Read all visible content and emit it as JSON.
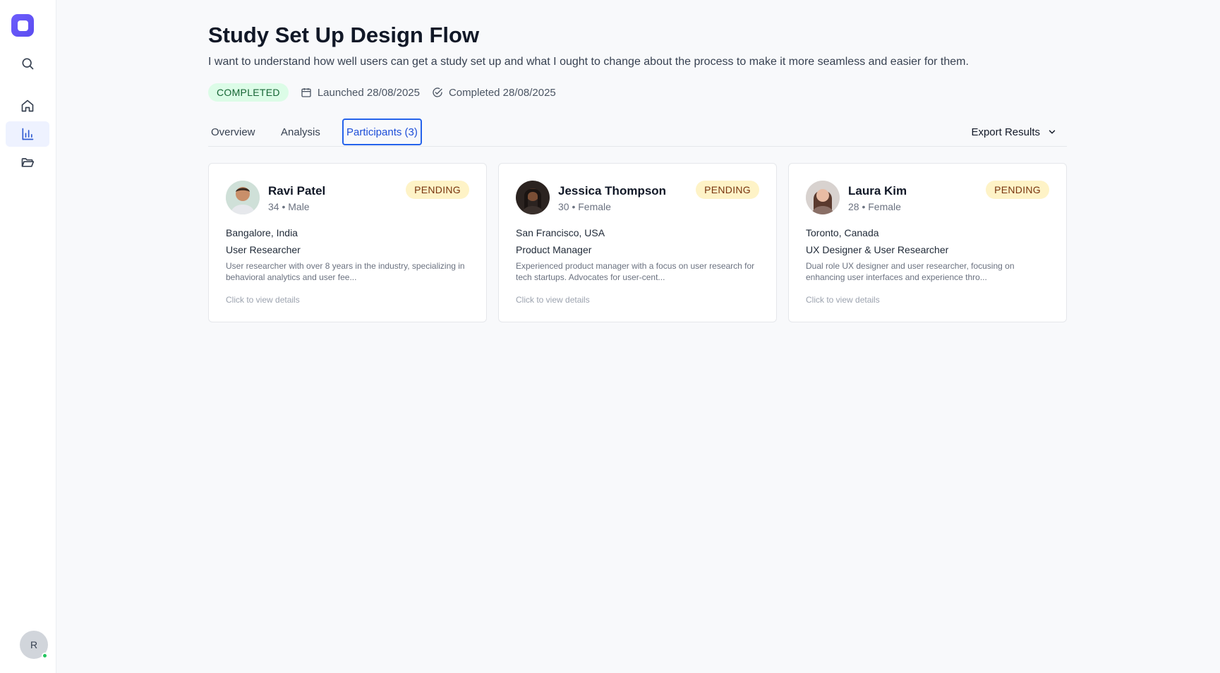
{
  "sidebar": {
    "avatar_initial": "R",
    "items": [
      {
        "name": "search-icon"
      },
      {
        "name": "home-icon"
      },
      {
        "name": "bar-chart-icon",
        "active": true
      },
      {
        "name": "folder-icon"
      }
    ]
  },
  "study": {
    "title": "Study Set Up Design Flow",
    "description": "I want to understand how well users can get a study set up and what I ought to change about the process to make it more seamless and easier for them.",
    "status": "COMPLETED",
    "launched": "Launched 28/08/2025",
    "completed": "Completed 28/08/2025"
  },
  "tabs": [
    {
      "label": "Overview"
    },
    {
      "label": "Analysis"
    },
    {
      "label": "Participants (3)",
      "active": true
    }
  ],
  "export_label": "Export Results",
  "participants": [
    {
      "name": "Ravi Patel",
      "demographics": "34 • Male",
      "status": "PENDING",
      "location": "Bangalore, India",
      "role": "User Researcher",
      "bio": "User researcher with over 8 years in the industry, specializing in behavioral analytics and user fee...",
      "hint": "Click to view details"
    },
    {
      "name": "Jessica Thompson",
      "demographics": "30 • Female",
      "status": "PENDING",
      "location": "San Francisco, USA",
      "role": "Product Manager",
      "bio": "Experienced product manager with a focus on user research for tech startups. Advocates for user-cent...",
      "hint": "Click to view details"
    },
    {
      "name": "Laura Kim",
      "demographics": "28 • Female",
      "status": "PENDING",
      "location": "Toronto, Canada",
      "role": "UX Designer & User Researcher",
      "bio": "Dual role UX designer and user researcher, focusing on enhancing user interfaces and experience thro...",
      "hint": "Click to view details"
    }
  ],
  "colors": {
    "accent": "#2563eb",
    "completed_badge": "#dcfce7",
    "pending_badge": "#fef3c7",
    "logo": "#6d5dfc"
  }
}
